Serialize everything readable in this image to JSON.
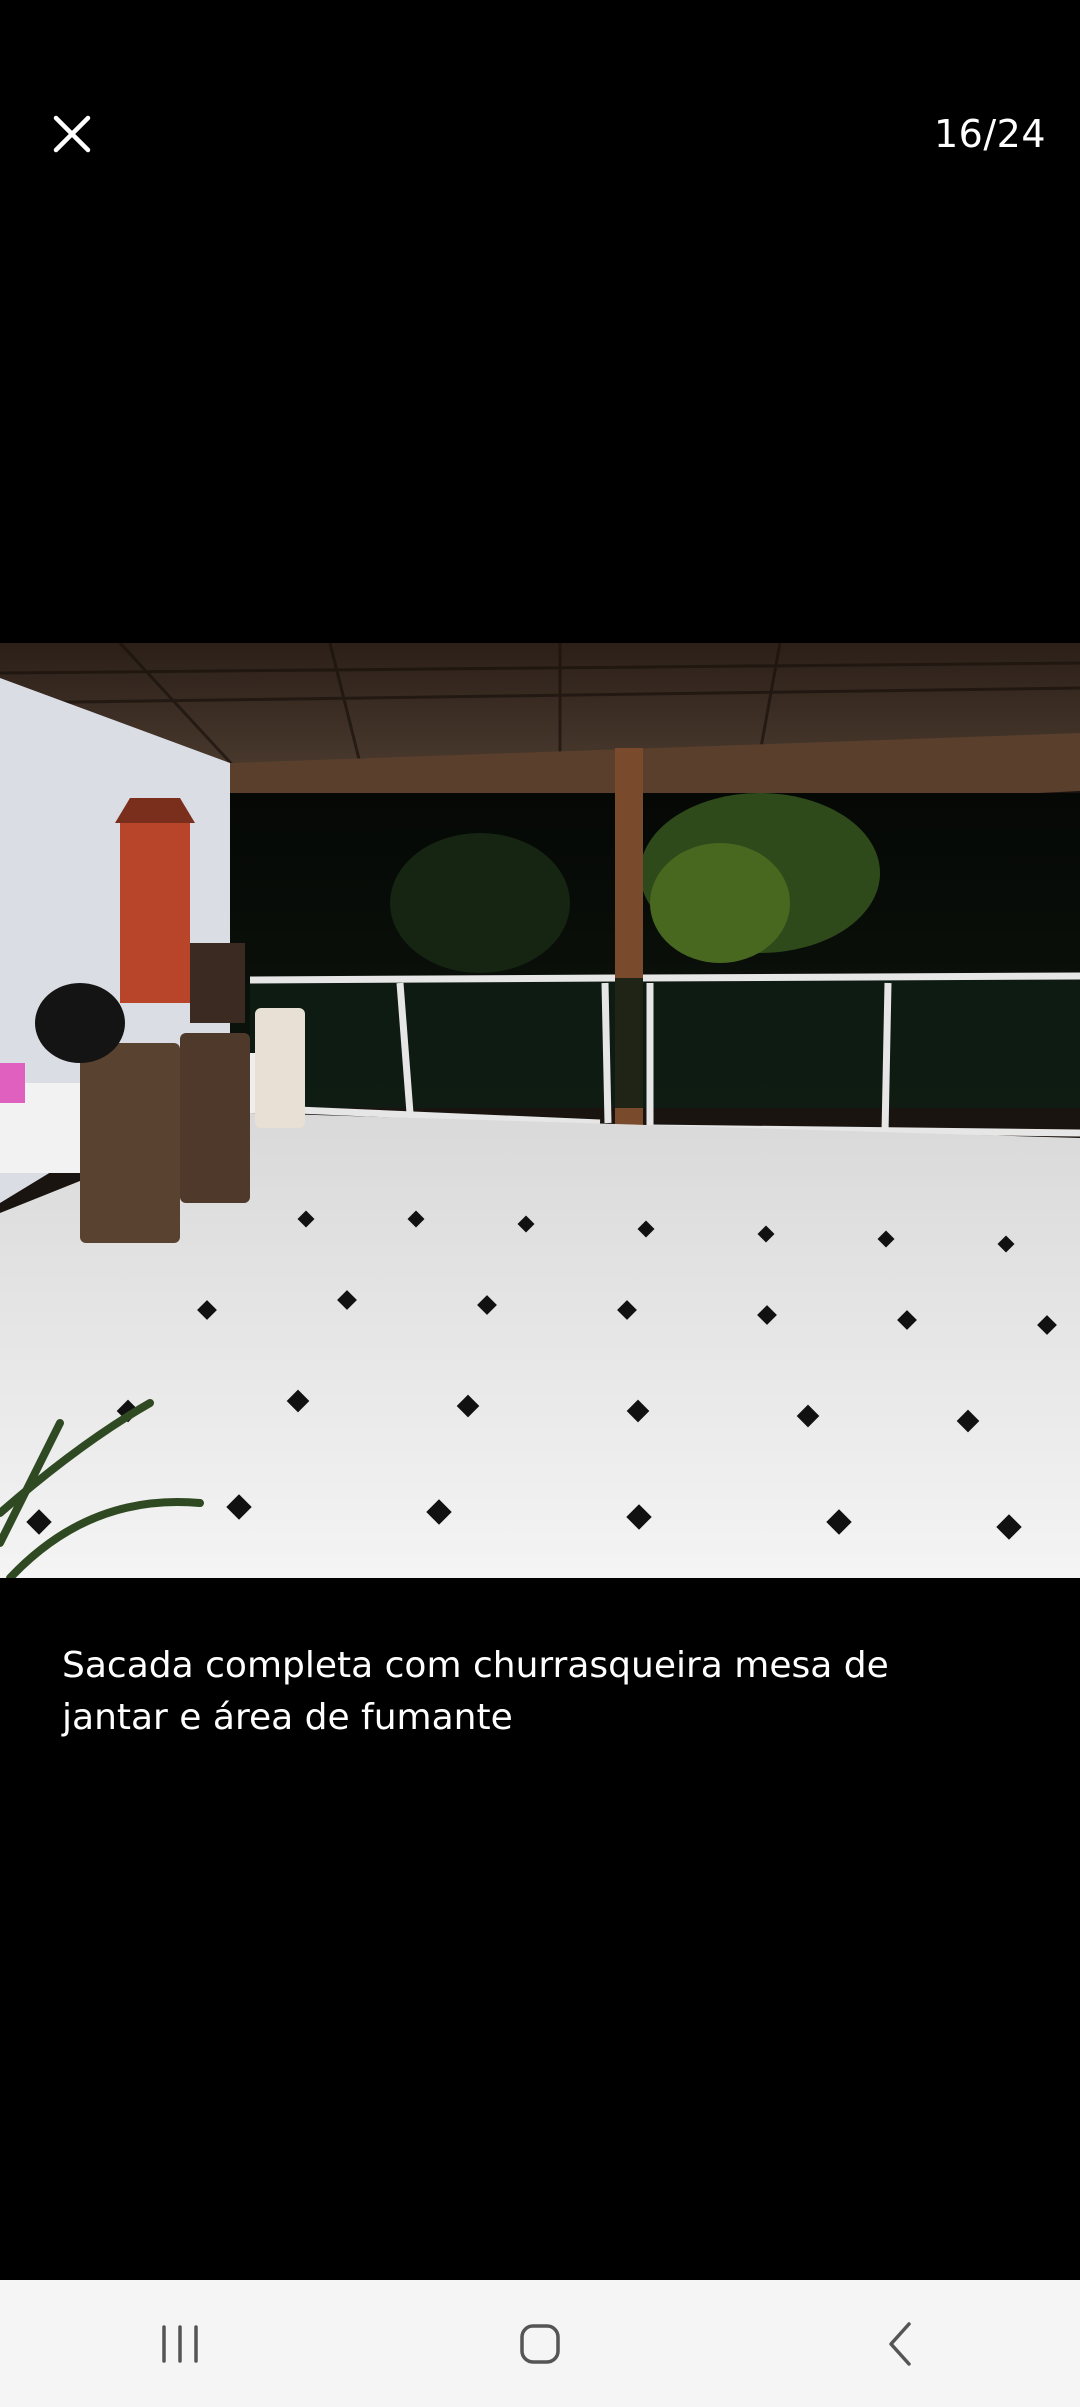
{
  "header": {
    "close_icon": "close-icon",
    "counter": "16/24"
  },
  "photo": {
    "description_icon": "photo"
  },
  "caption": {
    "text": "Sacada completa com churrasqueira mesa de jantar e área de fumante"
  },
  "navbar": {
    "recents_icon": "recents-icon",
    "home_icon": "home-icon",
    "back_icon": "back-icon",
    "background": "#f5f5f5"
  }
}
